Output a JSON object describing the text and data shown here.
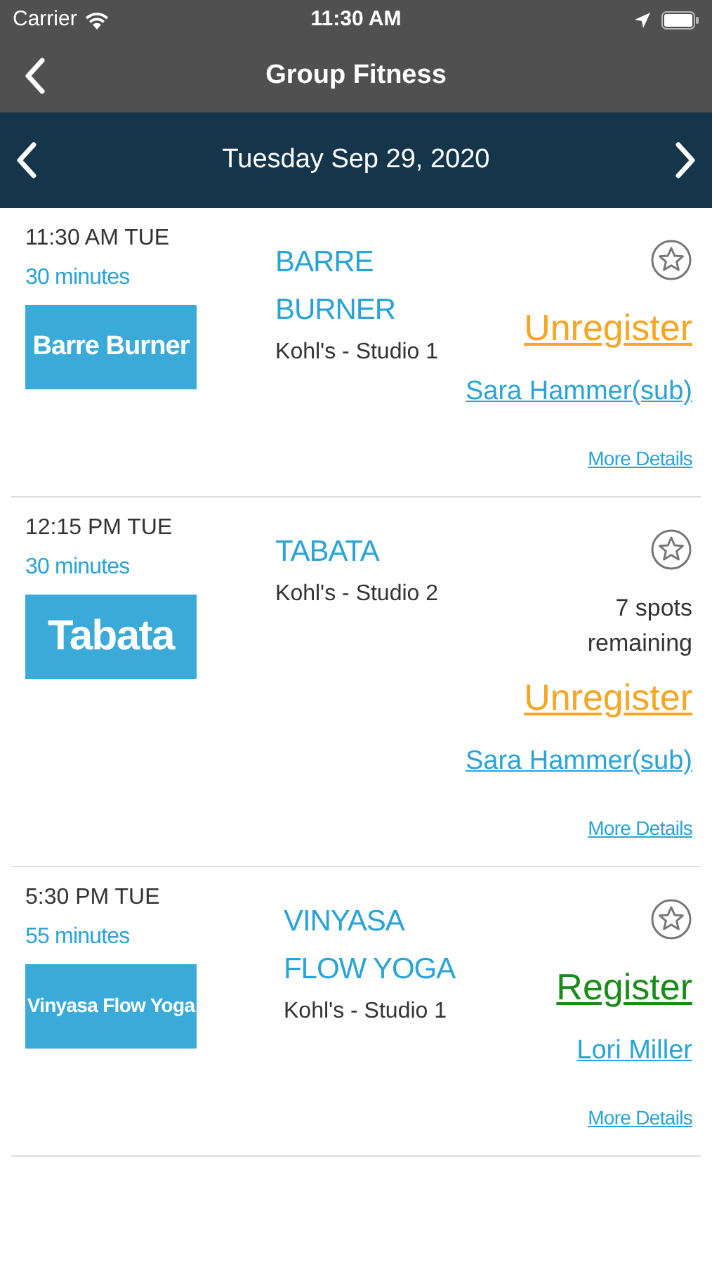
{
  "status_bar": {
    "carrier": "Carrier",
    "time": "11:30 AM"
  },
  "nav": {
    "title": "Group Fitness"
  },
  "date_bar": {
    "date": "Tuesday Sep 29, 2020"
  },
  "classes": [
    {
      "time": "11:30 AM TUE",
      "duration": "30 minutes",
      "thumbnail_text": "Barre Burner",
      "title": "BARRE BURNER",
      "location": "Kohl's - Studio 1",
      "favorite": false,
      "action": {
        "kind": "unregister",
        "label": "Unregister"
      },
      "instructor": "Sara Hammer(sub)",
      "details_link": "More Details"
    },
    {
      "time": "12:15 PM TUE",
      "duration": "30 minutes",
      "thumbnail_text": "Tabata",
      "title": "TABATA",
      "location": "Kohl's - Studio 2",
      "favorite": false,
      "spots": "7 spots remaining",
      "action": {
        "kind": "unregister",
        "label": "Unregister"
      },
      "instructor": "Sara Hammer(sub)",
      "details_link": "More Details"
    },
    {
      "time": "5:30 PM TUE",
      "duration": "55 minutes",
      "thumbnail_text": "Vinyasa Flow Yoga",
      "title": "VINYASA FLOW YOGA",
      "location": "Kohl's - Studio 1",
      "favorite": false,
      "action": {
        "kind": "register",
        "label": "Register"
      },
      "instructor": "Lori Miller",
      "details_link": "More Details"
    }
  ]
}
